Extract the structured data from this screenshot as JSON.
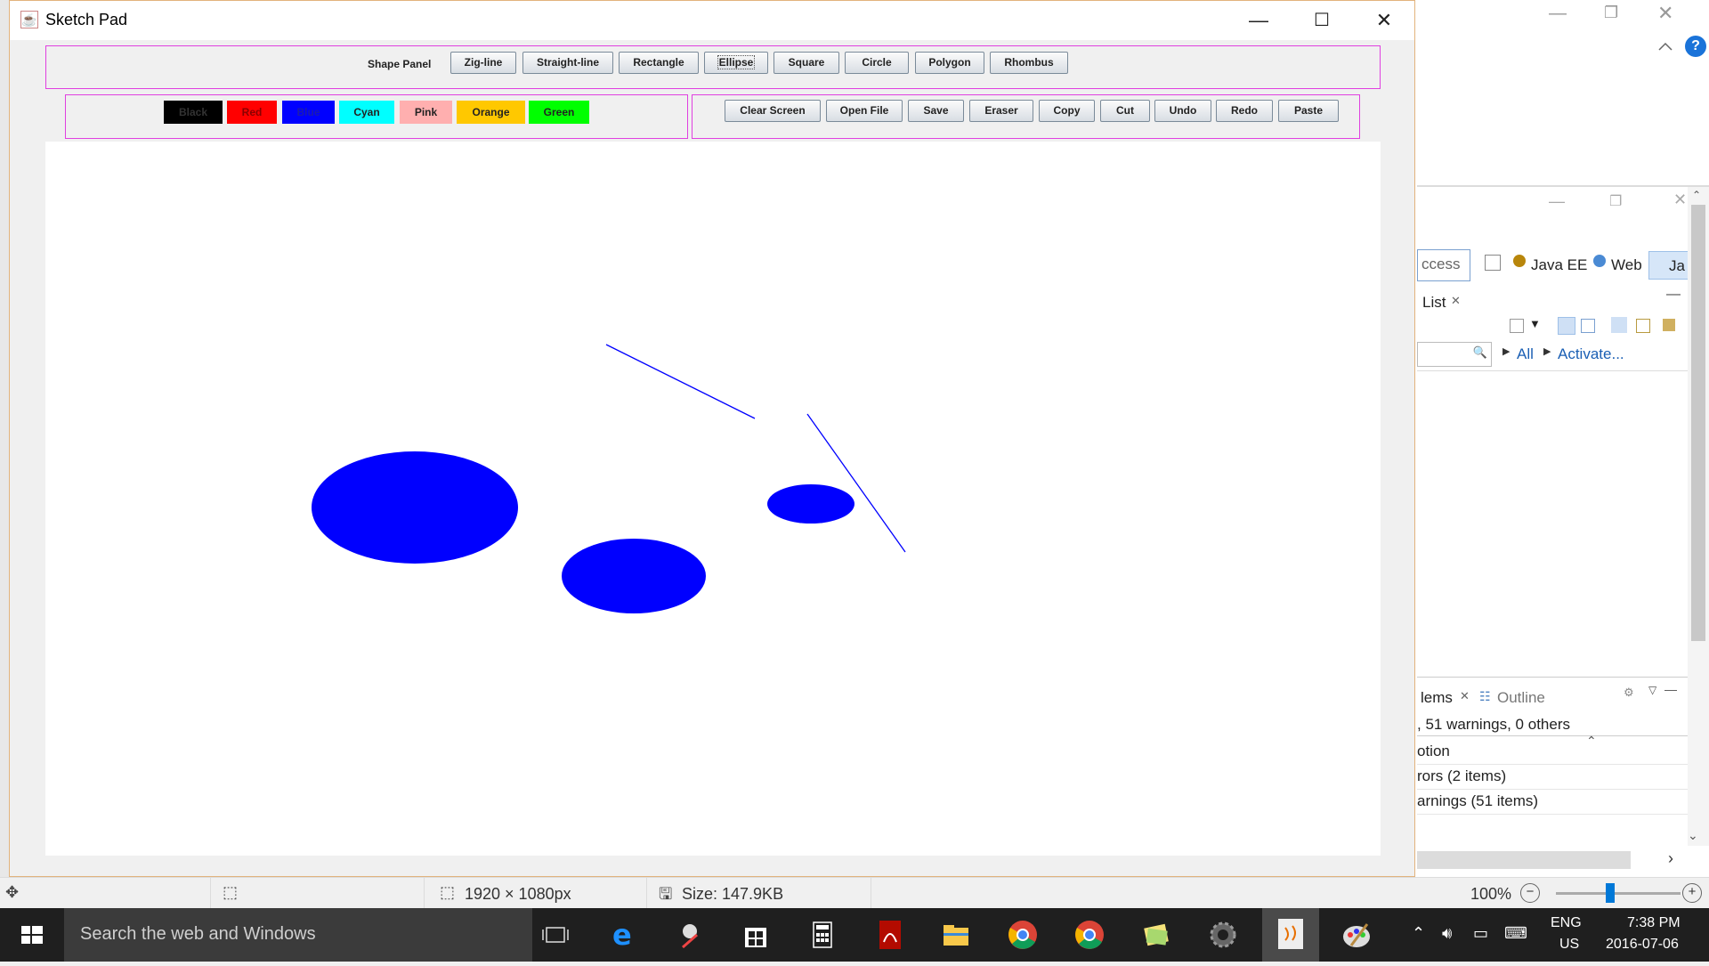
{
  "window": {
    "title": "Sketch Pad"
  },
  "shape_panel": {
    "label": "Shape Panel",
    "buttons": [
      "Zig-line",
      "Straight-line",
      "Rectangle",
      "Ellipse",
      "Square",
      "Circle",
      "Polygon",
      "Rhombus"
    ],
    "focused": "Ellipse"
  },
  "color_panel": {
    "buttons": [
      {
        "label": "Black",
        "color": "#000000",
        "text_color": "#333333"
      },
      {
        "label": "Red",
        "color": "#ff0000",
        "text_color": "#8a0000"
      },
      {
        "label": "Blue",
        "color": "#0000ff",
        "text_color": "#1b1bb0"
      },
      {
        "label": "Cyan",
        "color": "#00ffff",
        "text_color": "#222222"
      },
      {
        "label": "Pink",
        "color": "#ffafaf",
        "text_color": "#222222"
      },
      {
        "label": "Orange",
        "color": "#ffc800",
        "text_color": "#222222"
      },
      {
        "label": "Green",
        "color": "#00ff00",
        "text_color": "#222222"
      }
    ]
  },
  "action_panel": {
    "buttons": [
      "Clear Screen",
      "Open File",
      "Save",
      "Eraser",
      "Copy",
      "Cut",
      "Undo",
      "Redo",
      "Paste"
    ]
  },
  "canvas": {
    "stroke_color": "#0000ff",
    "fill_color": "#0000ff"
  },
  "background_app": {
    "toolbar_items": [
      "ccess",
      "Java EE",
      "Web",
      "Ja"
    ],
    "list_tab": "List",
    "links": [
      "All",
      "Activate..."
    ],
    "problems_tab": "lems",
    "outline_tab": "Outline",
    "summary": ", 51 warnings, 0 others",
    "column": "otion",
    "rows": [
      "rors (2 items)",
      "arnings (51 items)"
    ]
  },
  "status_bar": {
    "dimensions": "1920 × 1080px",
    "size": "Size: 147.9KB",
    "zoom": "100%"
  },
  "taskbar": {
    "search_placeholder": "Search the web and Windows",
    "language": "ENG",
    "region": "US",
    "time": "7:38 PM",
    "date": "2016-07-06"
  }
}
